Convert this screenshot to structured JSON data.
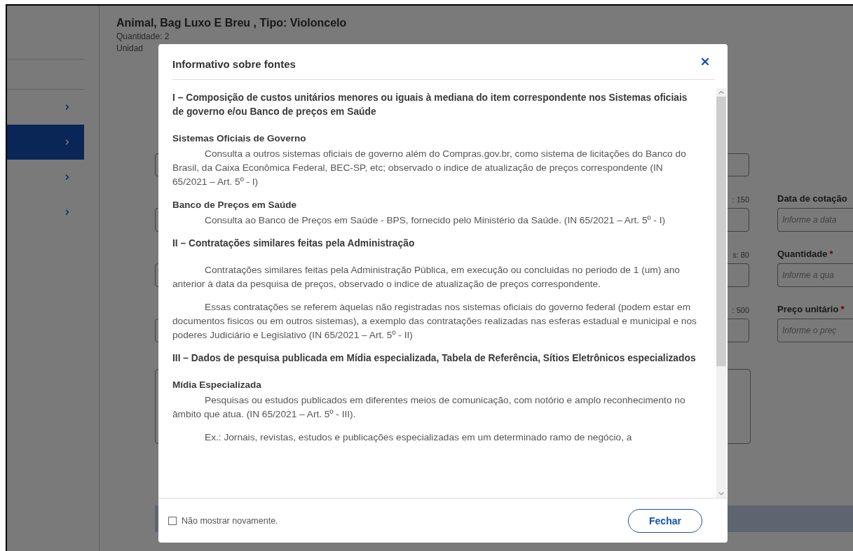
{
  "background": {
    "sidebar": {
      "items": [
        {
          "kind": "divider",
          "selected": false
        },
        {
          "kind": "divider",
          "selected": false
        },
        {
          "kind": "link",
          "selected": false
        },
        {
          "kind": "link",
          "selected": true
        },
        {
          "kind": "link",
          "selected": false
        },
        {
          "kind": "link",
          "selected": false
        }
      ]
    },
    "item_title": "Animal, Bag Luxo E Breu , Tipo: Violoncelo",
    "item_quantity": "Quantidade: 2",
    "item_unit": "Unidad",
    "rows": [
      {
        "counter": ": 150",
        "right_label": "Data de cotação",
        "right_placeholder": "Informe a data"
      },
      {
        "counter": "s: 80",
        "right_label": "Quantidade",
        "required_mark": "*",
        "right_placeholder": "Informe a qua"
      },
      {
        "counter": ": 500",
        "right_label": "Preço unitário",
        "required_mark": "*",
        "right_placeholder": "Informe o preç"
      }
    ]
  },
  "modal": {
    "title": "Informativo sobre fontes",
    "sections": [
      {
        "kind": "heading",
        "text": "I – Composição de custos unitários menores ou iguais à mediana do item correspondente nos Sistemas oficiais de governo e/ou Banco de preços em Saúde"
      },
      {
        "kind": "subheading",
        "text": "Sistemas Oficiais de Governo"
      },
      {
        "kind": "paragraph",
        "text": "Consulta a outros sistemas oficiais de governo além do Compras.gov.br, como sistema de licitações do Banco do Brasil, da Caixa Econômica Federal, BEC-SP, etc; observado o indice de atualização de preços correspondente (IN 65/2021 – Art. 5º - I)"
      },
      {
        "kind": "subheading",
        "text": "Banco de Preços em Saúde"
      },
      {
        "kind": "paragraph",
        "text": "Consulta ao Banco de Preços em Saúde - BPS, fornecido pelo Ministério da Saúde. (IN 65/2021 – Art. 5º - I)"
      },
      {
        "kind": "heading",
        "text": "II – Contratações similares feitas pela Administração"
      },
      {
        "kind": "paragraph",
        "text": "Contratações similares feitas pela Administração Pública, em execução ou concluidas no periodo de 1 (um) ano anterior à data da pesquisa de preços, observado o indice de atualização de preços correspondente."
      },
      {
        "kind": "paragraph",
        "text": "Essas contratações se referem àquelas não registradas nos sistemas oficiais do governo federal (podem estar em documentos fisicos ou em outros sistemas), a exemplo das contratações realizadas nas esferas estadual e municipal e nos poderes Judiciário e Legislativo (IN 65/2021 – Art. 5º - II)"
      },
      {
        "kind": "heading",
        "text": "III – Dados de pesquisa publicada em Mídia especializada, Tabela de Referência, Sítios Eletrônicos especializados"
      },
      {
        "kind": "subheading",
        "text": "Mídia Especializada"
      },
      {
        "kind": "paragraph",
        "text": "Pesquisas ou estudos publicados em diferentes meios de comunicação, com notório e amplo reconhecimento no âmbito que atua. (IN 65/2021 – Art. 5º - III)."
      },
      {
        "kind": "paragraph",
        "text": "Ex.: Jornais, revistas, estudos e publicações especializadas em um determinado ramo de negócio, a"
      }
    ],
    "dont_show_again": {
      "label": "Não mostrar novamente.",
      "checked": false
    },
    "close_button": "Fechar"
  }
}
